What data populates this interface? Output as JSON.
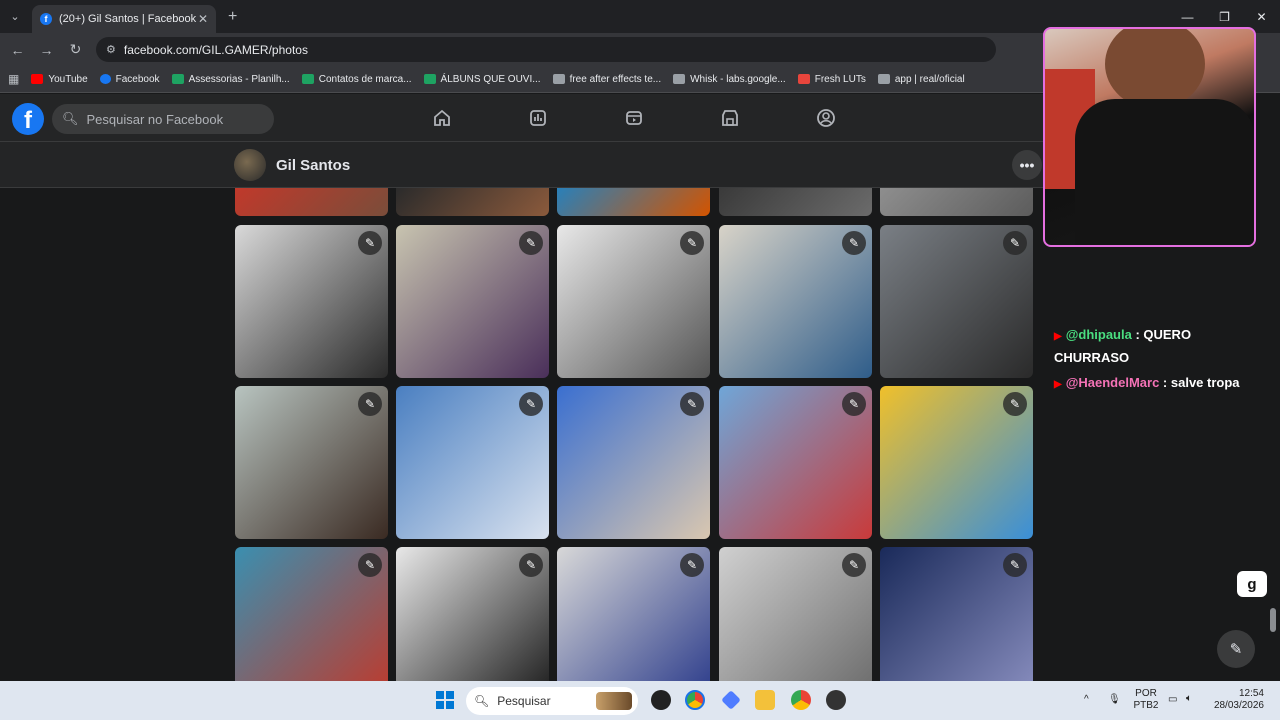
{
  "browser": {
    "tab_title": "(20+) Gil Santos | Facebook",
    "tab_favicon": "f",
    "tab_close": "✕",
    "new_tab": "+",
    "tab_menu": "⌄",
    "url": "facebook.com/GIL.GAMER/photos",
    "window_controls": [
      "—",
      "❐",
      "✕"
    ],
    "bookmarks": [
      {
        "label": "YouTube",
        "color": "#ff0000"
      },
      {
        "label": "Facebook",
        "color": "#1877f2"
      },
      {
        "label": "Assessorias - Planilh...",
        "color": "#1ea362"
      },
      {
        "label": "Contatos de marca...",
        "color": "#1ea362"
      },
      {
        "label": "ÁLBUNS QUE OUVI...",
        "color": "#1ea362"
      },
      {
        "label": "free after effects te...",
        "color": "#9aa0a6"
      },
      {
        "label": "Whisk - labs.google...",
        "color": "#9aa0a6"
      },
      {
        "label": "Fresh LUTs",
        "color": "#e8453c"
      },
      {
        "label": "app | real/oficial",
        "color": "#9aa0a6"
      }
    ]
  },
  "facebook": {
    "logo": "f",
    "search_placeholder": "Pesquisar no Facebook",
    "nav_icons": [
      "home-icon",
      "feed-icon",
      "video-icon",
      "marketplace-icon",
      "groups-icon"
    ],
    "profile_name": "Gil Santos",
    "more": "•••",
    "photo_rows": [
      [
        "#c0392b,#7a4d3a",
        "#2b2b2b,#8b5a3c",
        "#2980b9,#d35400",
        "#3a3a3a,#6b6b6b",
        "#8e8e8e,#5c5c5c"
      ],
      [
        "#d9d9d9,#2a2a2a",
        "#c8c4b0,#4a2f5a",
        "#e8e8e8,#555555",
        "#d8d3c8,#2f5d8a",
        "#7a7f85,#2a2a2a"
      ],
      [
        "#b8c4c0,#3a2a22",
        "#4a7fc1,#d9e2ef",
        "#3a6fd0,#d9c7b0",
        "#6fa6d8,#c93a3a",
        "#f0c02a,#3a8fd8"
      ],
      [
        "#3a8fb0,#c0392b",
        "#e8e8e8,#1a1a1a",
        "#d8d8d8,#2a3a8a",
        "#d0d0d0,#6a6a6a",
        "#1a2a5a,#8a8fc0"
      ]
    ]
  },
  "chat": [
    {
      "user": "@dhipaula",
      "sep": " : ",
      "text": "QUERO CHURRASO"
    },
    {
      "user": "@HaendelMarc",
      "sep": " : ",
      "text": "salve tropa"
    }
  ],
  "overlay": {
    "g_button": "g",
    "compose_icon": "✎"
  },
  "taskbar": {
    "search_placeholder": "Pesquisar",
    "lang_top": "POR",
    "lang_bottom": "PTB2",
    "time": "12:54",
    "date": "28/03/2026"
  }
}
